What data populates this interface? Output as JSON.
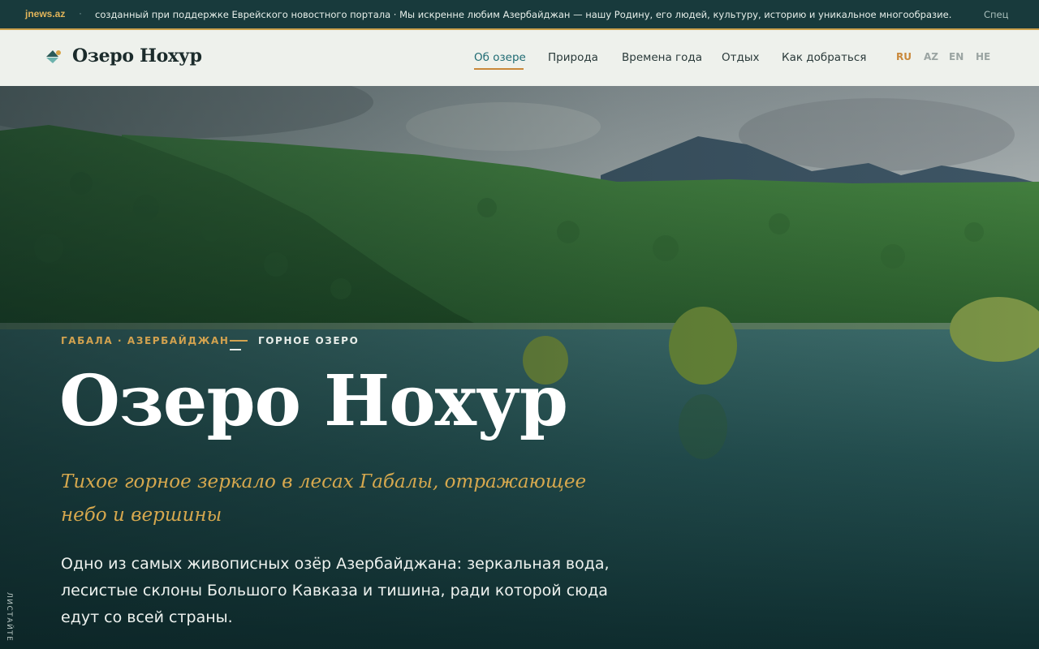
{
  "ticker": {
    "brand": "jnews.az",
    "separator": "·",
    "message": "созданный при поддержке Еврейского новостного портала · Мы искренне любим Азербайджан — нашу Родину, его людей, культуру, историю и уникальное многообразие.",
    "message_cont": "Спец"
  },
  "header": {
    "logo": "Озеро Нохур",
    "nav": [
      "Об озере",
      "Природа",
      "Времена года",
      "Отдых",
      "Как добраться"
    ],
    "active_nav": "Об озере",
    "languages": [
      "RU",
      "AZ",
      "EN",
      "HE"
    ],
    "active_language": "RU"
  },
  "hero": {
    "eyebrow_location": "ГАБАЛА · АЗЕРБАЙДЖАН",
    "eyebrow_type": "ГОРНОЕ ОЗЕРО",
    "title": "Озеро Нохур",
    "subtitle": "Тихое горное зеркало в лесах Габалы, отражающее небо и вершины",
    "lead": "Одно из самых живописных озёр Азербайджана: зеркальная вода, лесистые склоны Большого Кавказа и тишина, ради которой сюда едут со всей страны.",
    "scroll_hint": "ЛИСТАЙТЕ"
  },
  "colors": {
    "accent_gold": "#d2a24f",
    "accent_teal": "#1f6b73",
    "ticker_bg": "#183a3c",
    "header_bg": "#eef1ec"
  }
}
